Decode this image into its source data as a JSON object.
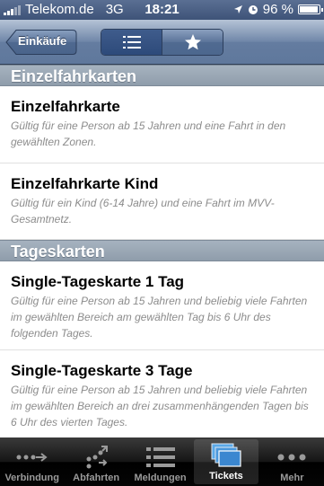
{
  "status_bar": {
    "carrier": "Telekom.de",
    "network": "3G",
    "time": "18:21",
    "battery_percent_label": "96 %",
    "battery_level": 0.96
  },
  "nav_bar": {
    "back_label": "Einkäufe",
    "segments": [
      {
        "icon": "list-icon",
        "selected": true
      },
      {
        "icon": "star-icon",
        "selected": false
      }
    ]
  },
  "sections": [
    {
      "header": "Einzelfahrkarten",
      "items": [
        {
          "title": "Einzelfahrkarte",
          "description": "Gültig für eine Person ab 15 Jahren und eine Fahrt in den gewählten Zonen."
        },
        {
          "title": "Einzelfahrkarte Kind",
          "description": "Gültig für ein Kind (6-14 Jahre) und eine Fahrt im MVV-Gesamtnetz."
        }
      ]
    },
    {
      "header": "Tageskarten",
      "items": [
        {
          "title": "Single-Tageskarte 1 Tag",
          "description": "Gültig für eine Person ab 15 Jahren und beliebig viele Fahrten im gewählten Bereich am gewählten Tag bis 6 Uhr des folgenden Tages."
        },
        {
          "title": "Single-Tageskarte 3 Tage",
          "description": "Gültig für eine Person ab 15 Jahren und beliebig viele Fahrten im gewählten Bereich an drei zusammenhängenden Tagen bis 6 Uhr des vierten Tages."
        }
      ]
    }
  ],
  "tab_bar": {
    "tabs": [
      {
        "label": "Verbindung",
        "icon": "connection-icon",
        "selected": false
      },
      {
        "label": "Abfahrten",
        "icon": "departures-icon",
        "selected": false
      },
      {
        "label": "Meldungen",
        "icon": "messages-icon",
        "selected": false
      },
      {
        "label": "Tickets",
        "icon": "tickets-icon",
        "selected": true
      },
      {
        "label": "Mehr",
        "icon": "more-icon",
        "selected": false
      }
    ]
  }
}
